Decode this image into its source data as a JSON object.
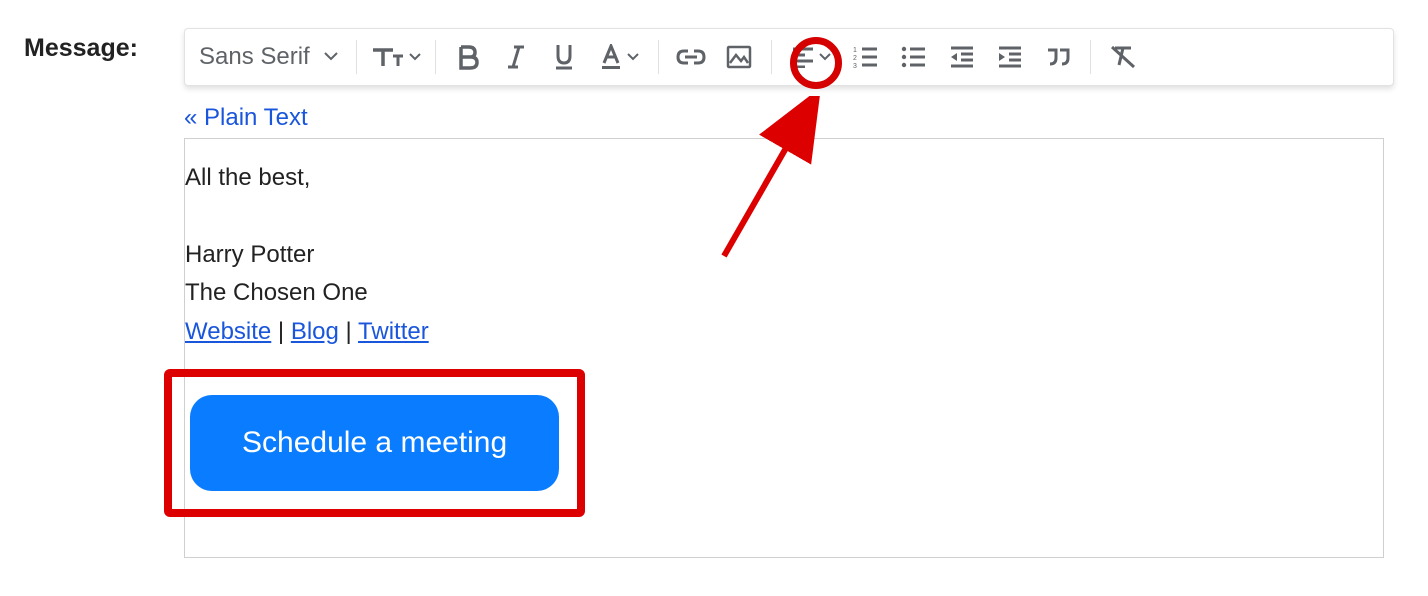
{
  "label": "Message:",
  "toolbar": {
    "font_family": "Sans Serif"
  },
  "plain_text_link": "« Plain Text",
  "signature": {
    "line1": "All the best,",
    "line2": "Harry Potter",
    "line3": "The Chosen One",
    "link_website": "Website",
    "link_blog": "Blog",
    "link_twitter": "Twitter",
    "sep": " | "
  },
  "cta_label": "Schedule a meeting",
  "annotation": {
    "highlight_tool": "link-icon",
    "highlight_element": "schedule-meeting-button"
  }
}
